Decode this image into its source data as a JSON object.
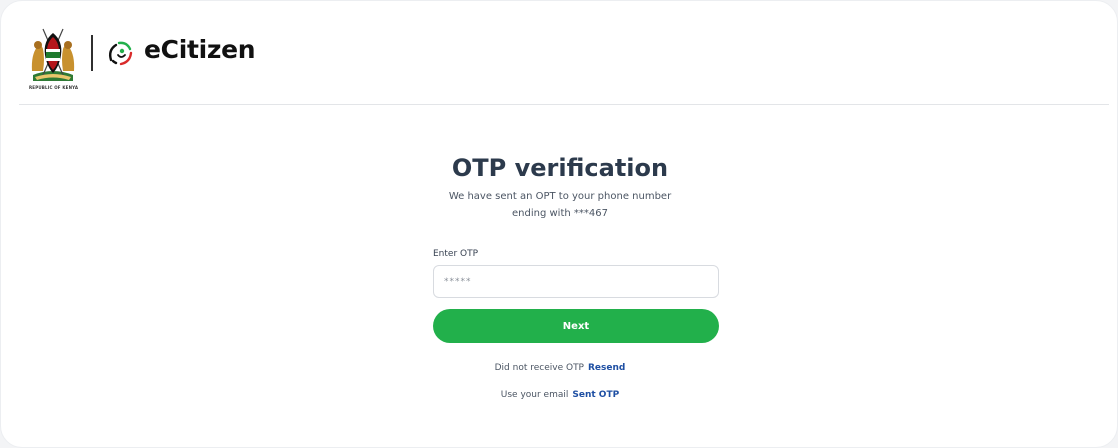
{
  "header": {
    "coat_caption": "REPUBLIC OF KENYA",
    "brand": "eCitizen"
  },
  "main": {
    "title": "OTP verification",
    "subtitle_line1": "We have sent an OPT to your phone number",
    "subtitle_line2": "ending with ***467",
    "otp_label": "Enter OTP",
    "otp_placeholder": "*****",
    "next_label": "Next",
    "resend_text": "Did not receive OTP",
    "resend_link": "Resend",
    "email_text": "Use your email",
    "email_link": "Sent OTP"
  },
  "colors": {
    "primary_button": "#22b04b",
    "link": "#1e4fa3"
  },
  "icons": [
    "kenya-coat-of-arms-icon",
    "ecitizen-logo-icon"
  ]
}
